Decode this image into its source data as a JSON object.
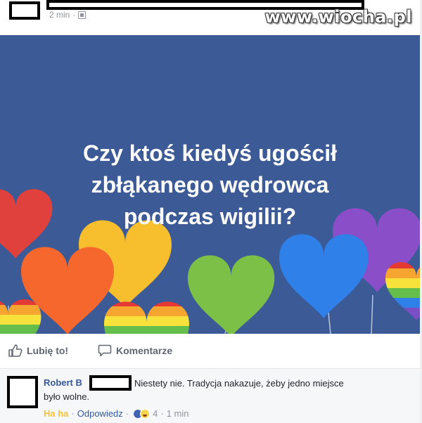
{
  "post": {
    "time": "2 min",
    "audience_icon": "audience-icon",
    "watermark": "www.wiocha.pl"
  },
  "card": {
    "background": "#3c5a96",
    "lines": [
      "Czy ktoś kiedyś ugościł",
      "zbłąkanego wędrowca",
      "podczas wigilii?"
    ]
  },
  "actions": {
    "like_label": "Lubię to!",
    "comment_label": "Komentarze"
  },
  "comment": {
    "author": "Robert B",
    "text_line1": "Niestety nie. Tradycja nakazuje, żeby jedno miejsce",
    "text_line2": "było wolne.",
    "reaction_given": "Ha ha",
    "reply_label": "Odpowiedz",
    "reaction_count": "4",
    "time": "1 min",
    "separator": "·"
  }
}
